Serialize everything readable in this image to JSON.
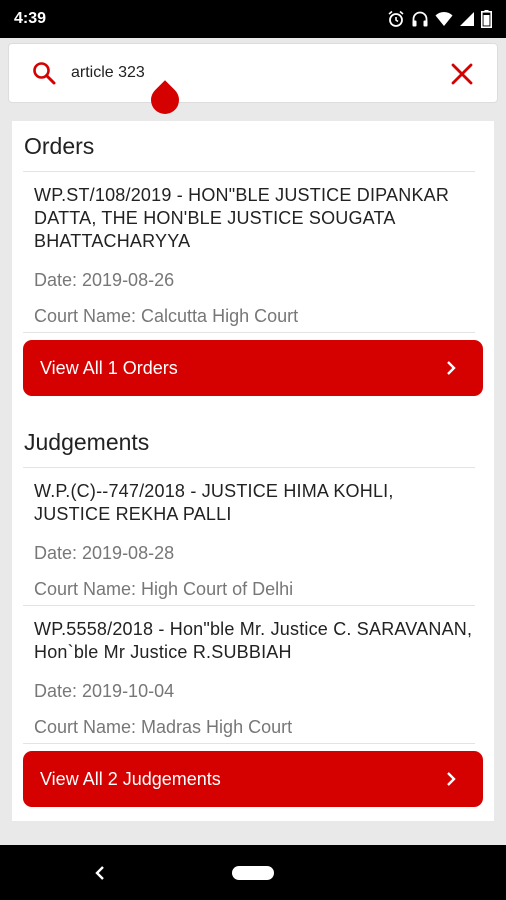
{
  "status_bar": {
    "time": "4:39",
    "icons": [
      "alarm-icon",
      "headset-icon",
      "wifi-icon",
      "signal-icon",
      "battery-icon"
    ]
  },
  "search": {
    "query": "article 323",
    "icon": "search-icon",
    "clear_icon": "close-icon"
  },
  "orders": {
    "heading": "Orders",
    "items": [
      {
        "title": "WP.ST/108/2019 - HON\"BLE JUSTICE DIPANKAR DATTA, THE HON'BLE JUSTICE SOUGATA BHATTACHARYYA",
        "date": "Date: 2019-08-26",
        "court": "Court Name: Calcutta High Court"
      }
    ],
    "view_all_label": "View All 1 Orders"
  },
  "judgements": {
    "heading": "Judgements",
    "items": [
      {
        "title": "W.P.(C)--747/2018 - JUSTICE HIMA KOHLI, JUSTICE REKHA PALLI",
        "date": "Date: 2019-08-28",
        "court": "Court Name: High Court of Delhi"
      },
      {
        "title": "WP.5558/2018 - Hon\"ble Mr. Justice C. SARAVANAN, Hon`ble  Mr Justice R.SUBBIAH",
        "date": "Date: 2019-10-04",
        "court": "Court Name: Madras High Court"
      }
    ],
    "view_all_label": "View All 2 Judgements"
  },
  "colors": {
    "accent": "#d50000",
    "background": "#e9e9e9",
    "card": "#ffffff",
    "muted_text": "#777777"
  }
}
